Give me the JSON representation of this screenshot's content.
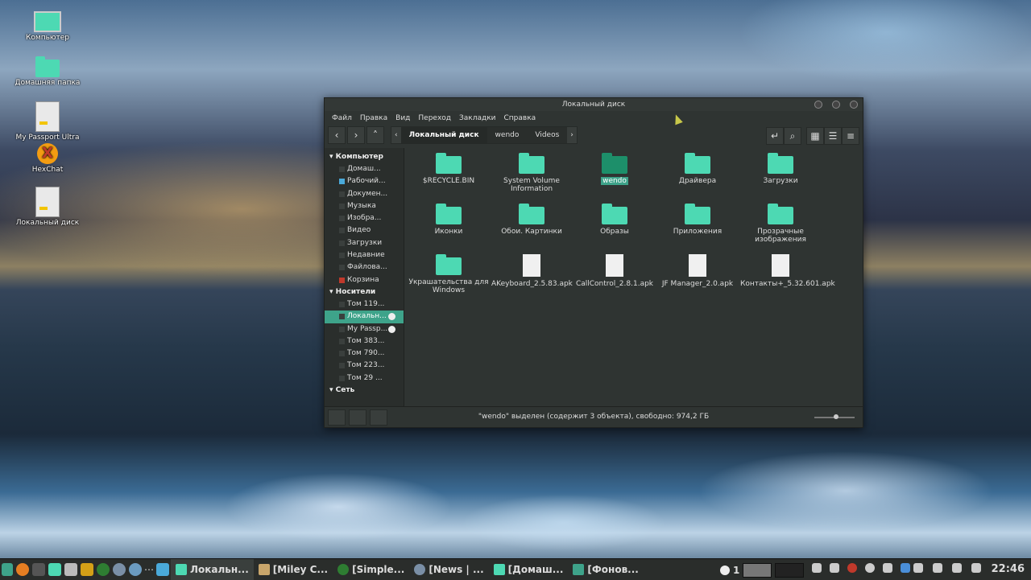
{
  "desktop_icons": [
    {
      "label": "Компьютер",
      "icon": "computer-icon"
    },
    {
      "label": "Домашняя папка",
      "icon": "home-folder-icon"
    },
    {
      "label": "My Passport Ultra",
      "icon": "drive-icon"
    },
    {
      "label": "HexChat",
      "icon": "hexchat-icon"
    },
    {
      "label": "Локальный диск",
      "icon": "drive-icon"
    }
  ],
  "window": {
    "title": "Локальный диск",
    "menu": [
      "Файл",
      "Правка",
      "Вид",
      "Переход",
      "Закладки",
      "Справка"
    ],
    "breadcrumbs": [
      "Локальный диск",
      "wendo",
      "Videos"
    ],
    "sidebar": {
      "computer_header": "Компьютер",
      "computer_items": [
        "Домаш...",
        "Рабочий...",
        "Докумен...",
        "Музыка",
        "Изобра...",
        "Видео",
        "Загрузки",
        "Недавние",
        "Файлова...",
        "Корзина"
      ],
      "media_header": "Носители",
      "media_items": [
        "Том 119...",
        "Локальн...",
        "My Passp...",
        "Том 383...",
        "Том 790...",
        "Том 223...",
        "Том 29 ..."
      ],
      "network_header": "Сеть"
    },
    "items": [
      {
        "name": "$RECYCLE.BIN",
        "type": "folder"
      },
      {
        "name": "System Volume Information",
        "type": "folder"
      },
      {
        "name": "wendo",
        "type": "folder",
        "selected": true
      },
      {
        "name": "Драйвера",
        "type": "folder"
      },
      {
        "name": "Загрузки",
        "type": "folder"
      },
      {
        "name": "Иконки",
        "type": "folder"
      },
      {
        "name": "Обои. Картинки",
        "type": "folder"
      },
      {
        "name": "Образы",
        "type": "folder"
      },
      {
        "name": "Приложения",
        "type": "folder"
      },
      {
        "name": "Прозрачные изображения",
        "type": "folder"
      },
      {
        "name": "Украшательства для Windows",
        "type": "folder"
      },
      {
        "name": "AKeyboard_2.5.83.apk",
        "type": "file"
      },
      {
        "name": "CallControl_2.8.1.apk",
        "type": "file"
      },
      {
        "name": "JF Manager_2.0.apk",
        "type": "file"
      },
      {
        "name": "Контакты+_5.32.601.apk",
        "type": "file"
      }
    ],
    "status": "\"wendo\" выделен (содержит 3 объекта), свободно: 974,2 ГБ"
  },
  "taskbar": {
    "tasks": [
      "Локальн...",
      "[Miley C...",
      "[Simple...",
      "[News | ...",
      "[Домаш...",
      "[Фонов..."
    ],
    "workspace": "1",
    "clock": "22:46"
  }
}
